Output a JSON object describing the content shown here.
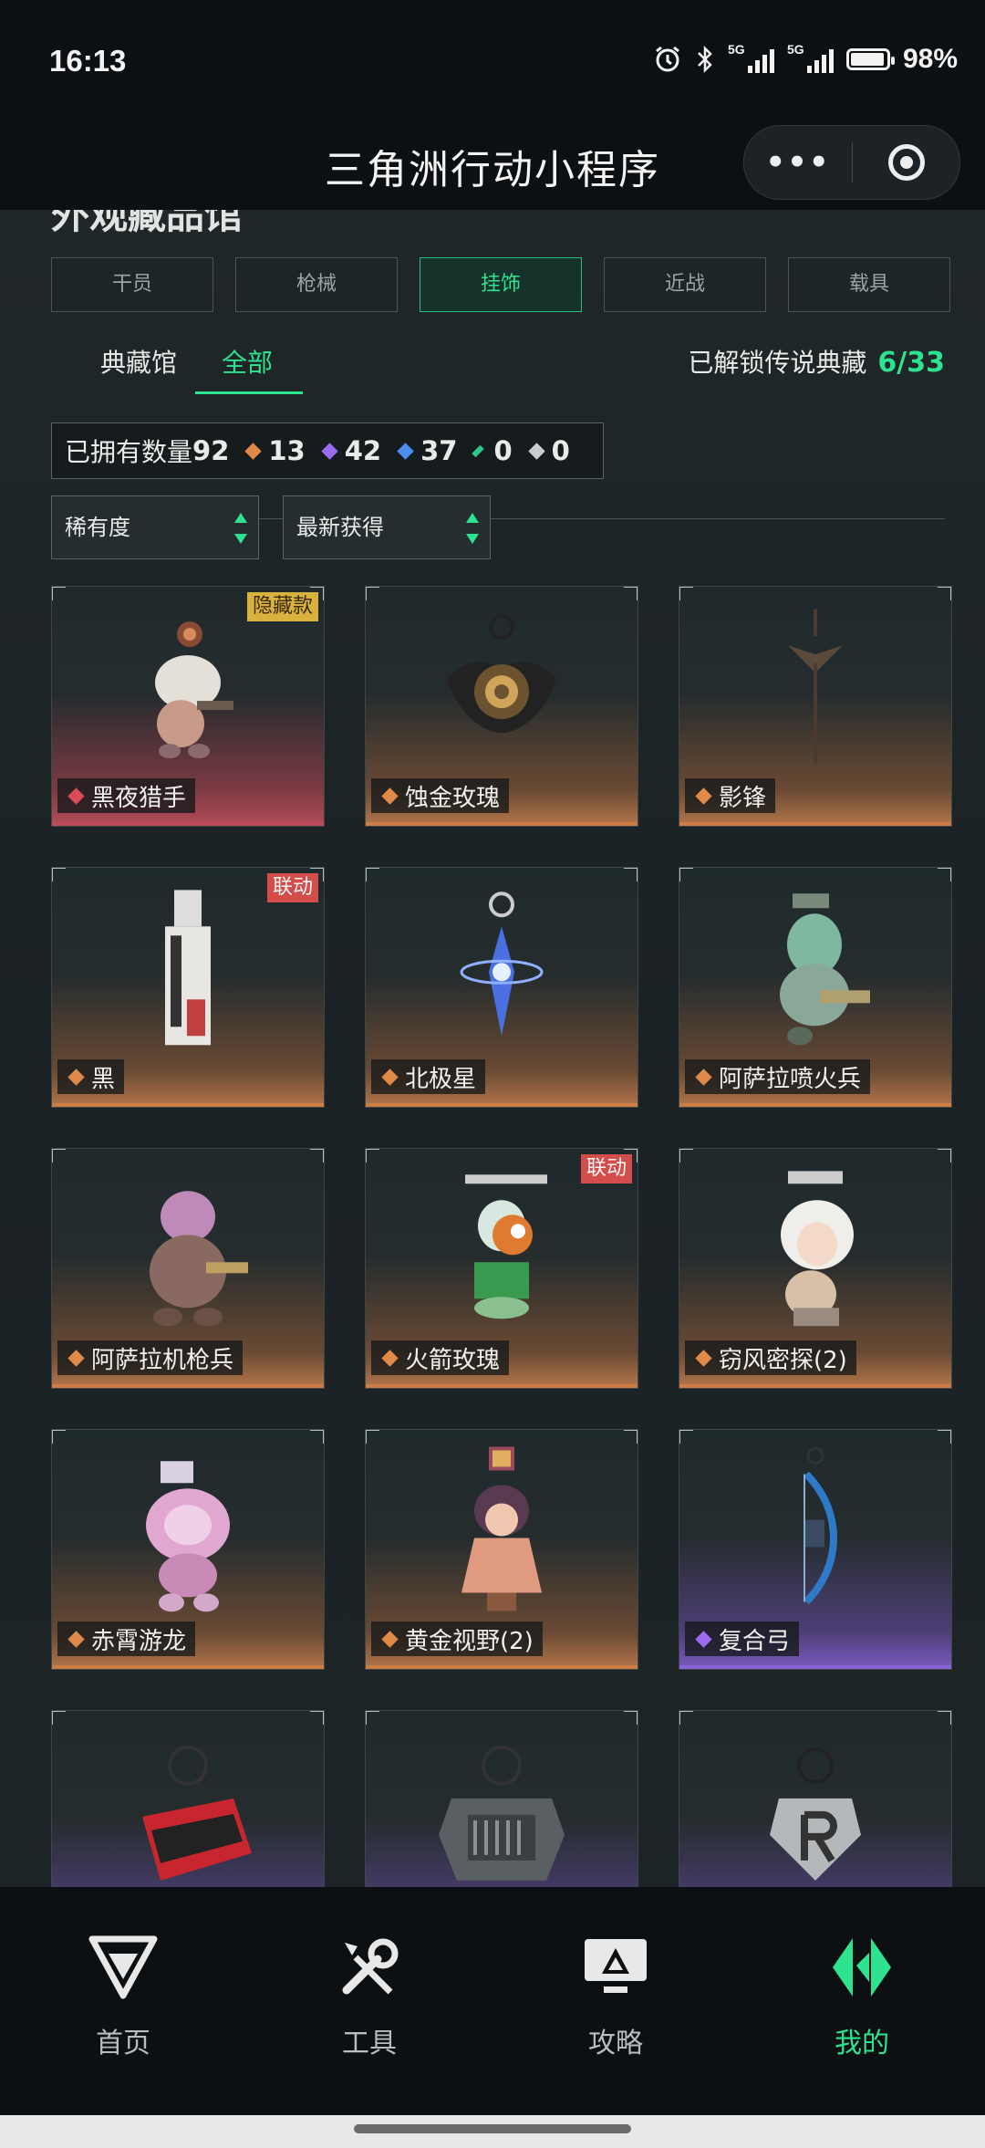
{
  "status_bar": {
    "time": "16:13",
    "network1": "5G",
    "network2": "5G",
    "battery": "98%"
  },
  "app": {
    "title": "三角洲行动小程序",
    "more_label": "•••"
  },
  "section": {
    "title": "外观藏品馆"
  },
  "categories": [
    {
      "label": "干员",
      "active": false
    },
    {
      "label": "枪械",
      "active": false
    },
    {
      "label": "挂饰",
      "active": true
    },
    {
      "label": "近战",
      "active": false
    },
    {
      "label": "载具",
      "active": false
    }
  ],
  "subtabs": {
    "collection": "典藏馆",
    "all": "全部",
    "unlock_label": "已解锁传说典藏",
    "unlock_count": "6/33"
  },
  "counts": {
    "label": "已拥有数量",
    "total": "92",
    "red": "13",
    "purple": "42",
    "blue": "37",
    "green": "0",
    "gray": "0"
  },
  "colors": {
    "accent": "#2ee38f",
    "red_gem": "#d84b57",
    "orange_gem": "#e08a4a",
    "purple_gem": "#9c6cf0",
    "blue_gem": "#4a8ff0",
    "green_gem": "#31c58a",
    "gray_gem": "#c9cdcd"
  },
  "filters": {
    "rarity": "稀有度",
    "sort": "最新获得"
  },
  "items": [
    {
      "name": "黑夜猎手",
      "rarity": "red",
      "tag": "隐藏款",
      "icon": "cat-rider-charm-icon"
    },
    {
      "name": "蚀金玫瑰",
      "rarity": "orange",
      "tag": "",
      "icon": "gold-rose-charm-icon"
    },
    {
      "name": "影锋",
      "rarity": "orange",
      "tag": "",
      "icon": "blade-charm-icon"
    },
    {
      "name": "黑",
      "rarity": "orange",
      "tag": "联动",
      "icon": "card-charm-icon"
    },
    {
      "name": "北极星",
      "rarity": "orange",
      "tag": "",
      "icon": "star-charm-icon"
    },
    {
      "name": "阿萨拉喷火兵",
      "rarity": "orange",
      "tag": "",
      "icon": "flamethrower-charm-icon"
    },
    {
      "name": "阿萨拉机枪兵",
      "rarity": "orange",
      "tag": "",
      "icon": "gunner-charm-icon"
    },
    {
      "name": "火箭玫瑰",
      "rarity": "orange",
      "tag": "联动",
      "icon": "rocket-rose-charm-icon"
    },
    {
      "name": "窃风密探(2)",
      "rarity": "orange",
      "tag": "",
      "icon": "spy-charm-icon"
    },
    {
      "name": "赤霄游龙",
      "rarity": "orange",
      "tag": "",
      "icon": "dragon-charm-icon"
    },
    {
      "name": "黄金视野(2)",
      "rarity": "orange",
      "tag": "",
      "icon": "golden-vision-charm-icon"
    },
    {
      "name": "复合弓",
      "rarity": "purple",
      "tag": "",
      "icon": "bow-charm-icon"
    },
    {
      "name": "",
      "rarity": "purple",
      "tag": "",
      "icon": "red-box-charm-icon"
    },
    {
      "name": "",
      "rarity": "purple",
      "tag": "",
      "icon": "crate-charm-icon"
    },
    {
      "name": "",
      "rarity": "purple",
      "tag": "",
      "icon": "letter-r-charm-icon"
    }
  ],
  "nav": [
    {
      "label": "首页",
      "icon": "home-logo-icon",
      "active": false
    },
    {
      "label": "工具",
      "icon": "tools-icon",
      "active": false
    },
    {
      "label": "攻略",
      "icon": "guide-monitor-icon",
      "active": false
    },
    {
      "label": "我的",
      "icon": "profile-logo-icon",
      "active": true
    }
  ]
}
